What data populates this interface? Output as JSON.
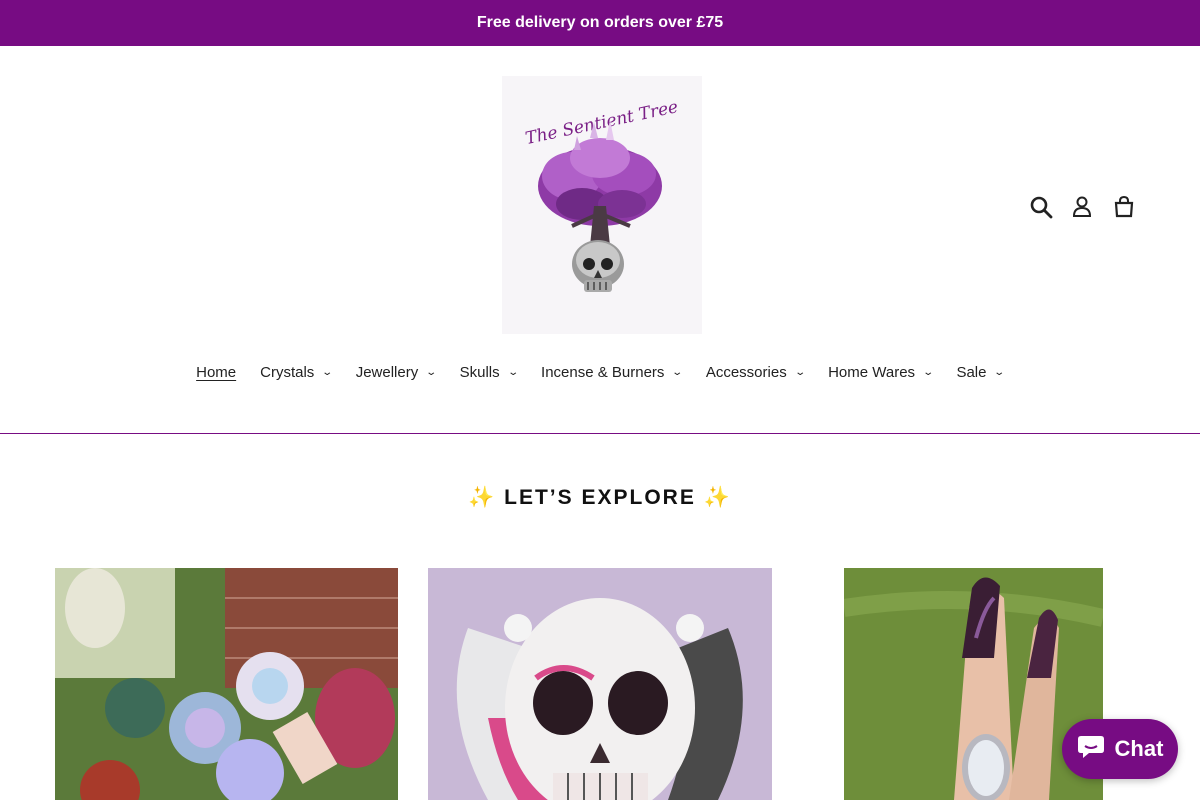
{
  "announcement": "Free delivery on orders over £75",
  "logo": {
    "text": "The Sentient Tree"
  },
  "header_icons": [
    "search-icon",
    "user-icon",
    "cart-icon"
  ],
  "nav": [
    {
      "label": "Home",
      "active": true,
      "dropdown": false
    },
    {
      "label": "Crystals",
      "dropdown": true
    },
    {
      "label": "Jewellery",
      "dropdown": true
    },
    {
      "label": "Skulls",
      "dropdown": true
    },
    {
      "label": "Incense & Burners",
      "dropdown": true
    },
    {
      "label": "Accessories",
      "dropdown": true
    },
    {
      "label": "Home Wares",
      "dropdown": true
    },
    {
      "label": "Sale",
      "dropdown": true
    }
  ],
  "section_title": "✨ LET’S EXPLORE ✨",
  "chat": {
    "label": "Chat",
    "icon": "chat-bubble-icon"
  },
  "colors": {
    "brand": "#770c83",
    "text": "#222222"
  }
}
